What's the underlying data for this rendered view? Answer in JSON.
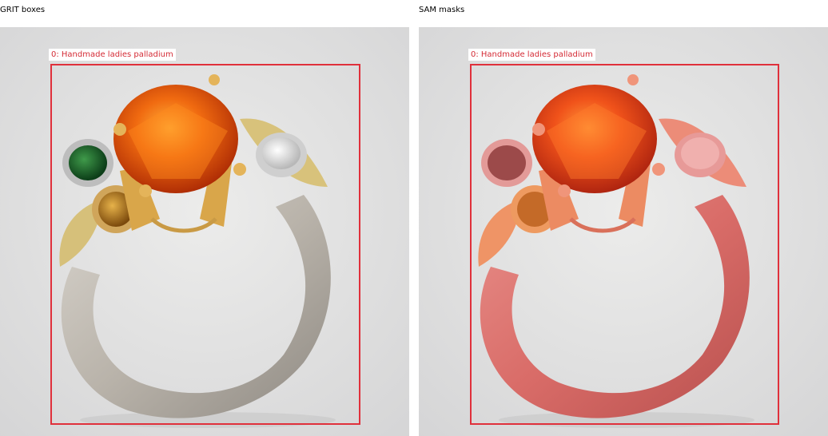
{
  "panels": {
    "left": {
      "title": "GRIT boxes"
    },
    "right": {
      "title": "SAM masks"
    }
  },
  "detections": [
    {
      "label": "0: Handmade ladies palladium",
      "color": "#e0303b"
    }
  ],
  "mask_color": "#e05a5a",
  "scene": {
    "subject": "ring",
    "background": "#dcdcdc"
  }
}
